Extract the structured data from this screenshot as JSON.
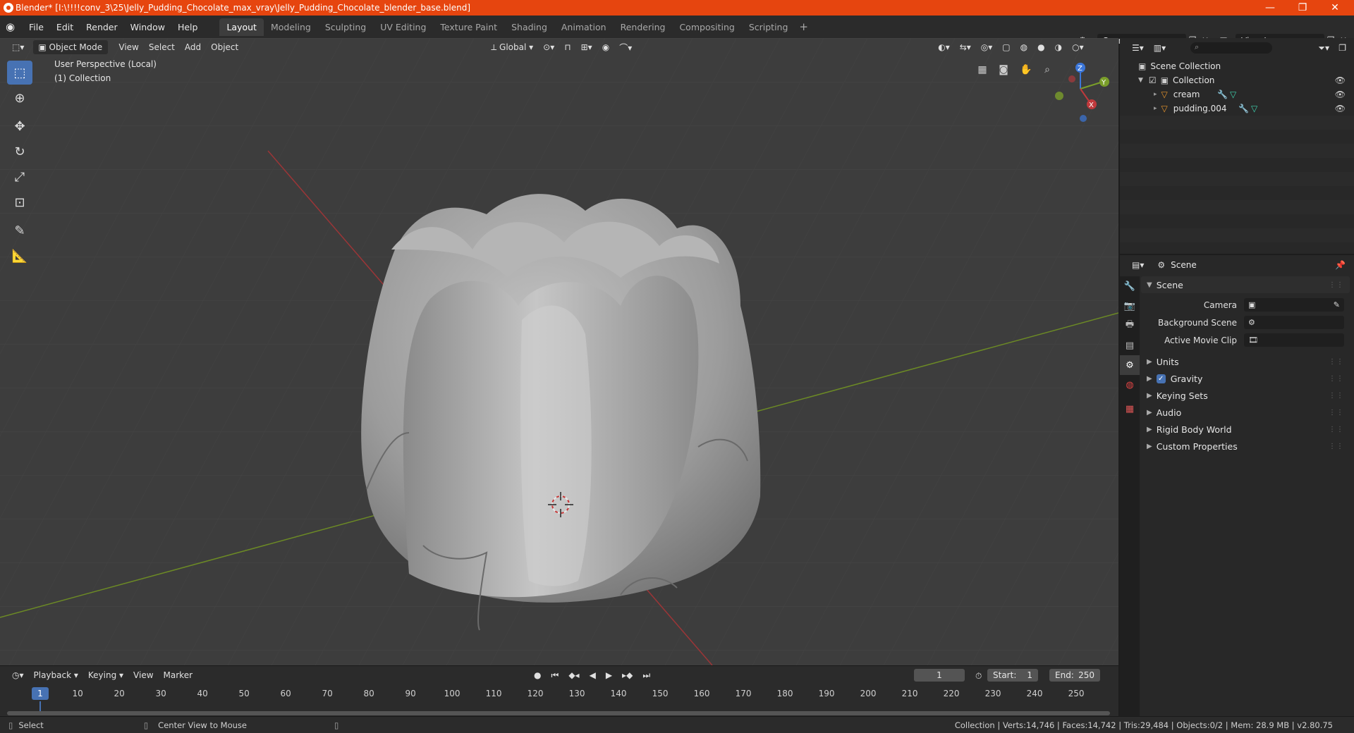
{
  "window": {
    "title": "Blender* [I:\\!!!!conv_3\\25\\Jelly_Pudding_Chocolate_max_vray\\Jelly_Pudding_Chocolate_blender_base.blend]",
    "minimize": "—",
    "maximize": "❐",
    "close": "✕"
  },
  "menu": {
    "file": "File",
    "edit": "Edit",
    "render": "Render",
    "window": "Window",
    "help": "Help"
  },
  "workspaces": [
    "Layout",
    "Modeling",
    "Sculpting",
    "UV Editing",
    "Texture Paint",
    "Shading",
    "Animation",
    "Rendering",
    "Compositing",
    "Scripting"
  ],
  "active_workspace": "Layout",
  "scene_name": "Scene",
  "view_layer": "View Layer",
  "viewport": {
    "mode": "Object Mode",
    "view": "View",
    "select": "Select",
    "add": "Add",
    "object": "Object",
    "transform": "Global",
    "info_line1": "User Perspective (Local)",
    "info_line2": "(1) Collection",
    "gizmo": {
      "x": "X",
      "y": "Y",
      "z": "Z"
    }
  },
  "outliner": {
    "search_placeholder": "",
    "root": "Scene Collection",
    "collection": "Collection",
    "objects": [
      "cream",
      "pudding.004"
    ]
  },
  "properties": {
    "context": "Scene",
    "panel_scene": "Scene",
    "camera_label": "Camera",
    "bg_scene_label": "Background Scene",
    "movie_clip_label": "Active Movie Clip",
    "sub_panels": [
      "Units",
      "Gravity",
      "Keying Sets",
      "Audio",
      "Rigid Body World",
      "Custom Properties"
    ],
    "gravity_enabled": true
  },
  "timeline": {
    "playback": "Playback",
    "keying": "Keying",
    "view": "View",
    "marker": "Marker",
    "current_frame": "1",
    "start_label": "Start:",
    "start": "1",
    "end_label": "End:",
    "end": "250",
    "ruler": [
      "1",
      "10",
      "20",
      "30",
      "40",
      "50",
      "60",
      "70",
      "80",
      "90",
      "100",
      "110",
      "120",
      "130",
      "140",
      "150",
      "160",
      "170",
      "180",
      "190",
      "200",
      "210",
      "220",
      "230",
      "240",
      "250"
    ]
  },
  "status": {
    "left": "Select",
    "middle": "Center View to Mouse",
    "right": "Collection | Verts:14,746 | Faces:14,742 | Tris:29,484 | Objects:0/2 | Mem: 28.9 MB | v2.80.75"
  },
  "colors": {
    "accent": "#4772b3",
    "titlebar": "#e6450f",
    "x_axis": "#c0393c",
    "y_axis": "#7a9e2a",
    "z_axis": "#3b76d9"
  }
}
